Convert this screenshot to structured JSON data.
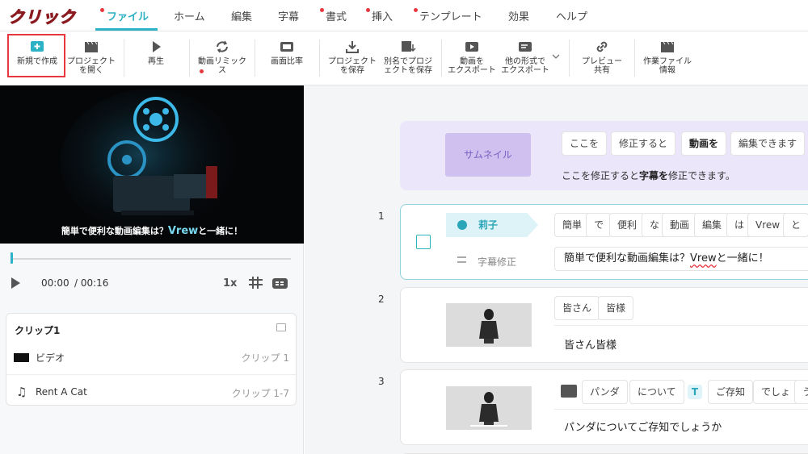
{
  "overlay_text": "クリック",
  "menu": {
    "items": [
      {
        "label": "ファイル",
        "active": true,
        "dot": true
      },
      {
        "label": "ホーム",
        "active": false,
        "dot": false
      },
      {
        "label": "編集",
        "active": false,
        "dot": false
      },
      {
        "label": "字幕",
        "active": false,
        "dot": false
      },
      {
        "label": "書式",
        "active": false,
        "dot": true
      },
      {
        "label": "挿入",
        "active": false,
        "dot": true
      },
      {
        "label": "テンプレート",
        "active": false,
        "dot": true
      },
      {
        "label": "効果",
        "active": false,
        "dot": false
      },
      {
        "label": "ヘルプ",
        "active": false,
        "dot": false
      }
    ]
  },
  "toolbar": {
    "new": "新規で作成",
    "open": "プロジェクト\nを開く",
    "play": "再生",
    "remix": "動画リミック\nス",
    "ratio": "画面比率",
    "save": "プロジェクト\nを保存",
    "save_as": "別名でプロジ\nェクトを保存",
    "export_video": "動画を\nエクスポート",
    "export_other": "他の形式で\nエクスポート",
    "share": "プレビュー\n共有",
    "info": "作業ファイル\n情報"
  },
  "preview": {
    "caption_pre": "簡単で便利な動画編集は？",
    "caption_brand": "Vrew",
    "caption_post": "と一緒に！"
  },
  "player": {
    "current_time": "00:00",
    "total_time": "/ 00:16",
    "speed": "1x"
  },
  "clips_panel": {
    "title": "クリップ1",
    "rows": [
      {
        "name": "ビデオ",
        "range": "クリップ 1"
      },
      {
        "name": "Rent A Cat",
        "range": "クリップ 1-7"
      }
    ]
  },
  "thumbnail_card": {
    "button": "サムネイル",
    "words": [
      "ここを",
      "修正すると",
      "動画を",
      "編集できます"
    ],
    "line_pre": "ここを修正すると",
    "line_bold": "字幕を",
    "line_post": "修正できます。"
  },
  "clip1": {
    "number": "1",
    "speaker": "莉子",
    "sub_label": "字幕修正",
    "words": [
      "簡単",
      "で",
      "便利",
      "な",
      "動画",
      "編集",
      "は",
      "Vrew",
      "と"
    ],
    "line_pre": "簡単で便利な動画編集は？",
    "line_brand": "Vrew",
    "line_post": "と一緒に！"
  },
  "clip2": {
    "number": "2",
    "words": [
      "皆さん",
      "皆様"
    ],
    "line": "皆さん皆様"
  },
  "clip3": {
    "number": "3",
    "words": [
      "パンダ",
      "について",
      "ご存知",
      "でしょ",
      "う"
    ],
    "line": "パンダについてご存知でしょうか"
  },
  "colors": {
    "accent": "#2cb2c4",
    "highlight_red": "#e8373e",
    "thumbnail_bg": "#ece6fb"
  }
}
